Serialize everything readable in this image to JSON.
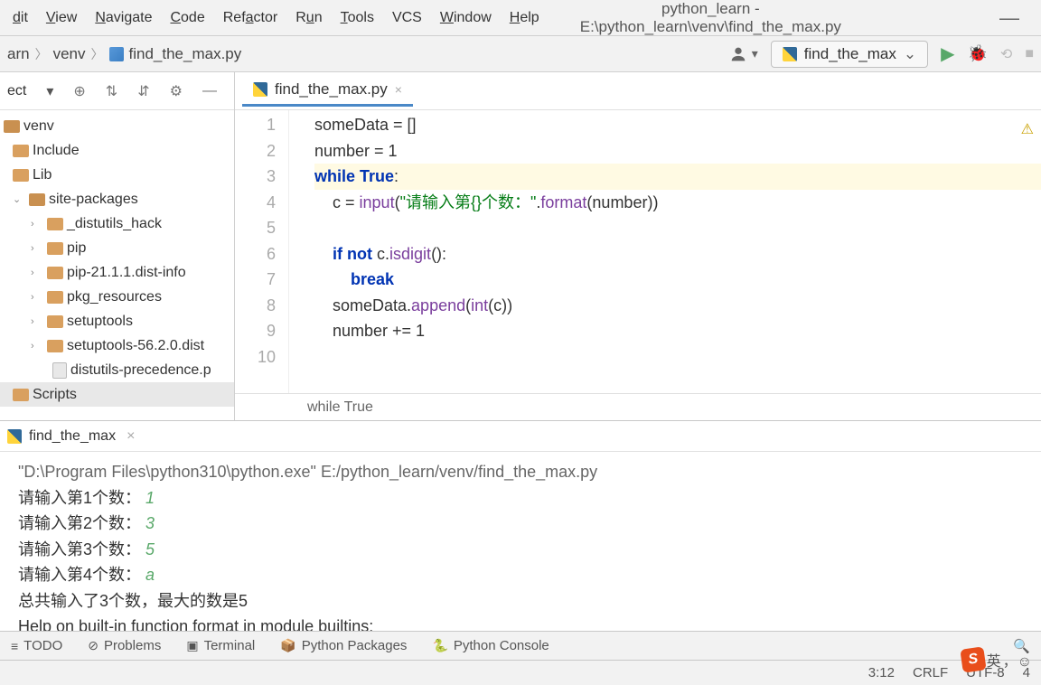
{
  "menu": {
    "items": [
      "dit",
      "View",
      "Navigate",
      "Code",
      "Refactor",
      "Run",
      "Tools",
      "VCS",
      "Window",
      "Help"
    ],
    "underline": [
      0,
      0,
      0,
      0,
      3,
      0,
      0,
      -1,
      0,
      0
    ]
  },
  "window_title": "python_learn - E:\\python_learn\\venv\\find_the_max.py",
  "breadcrumb": {
    "root": "arn",
    "mid": "venv",
    "file": "find_the_max.py"
  },
  "run_config": "find_the_max",
  "sidebar_label": "ect",
  "tree": {
    "root": "venv",
    "include": "Include",
    "lib": "Lib",
    "sitepkg": "site-packages",
    "items": [
      "_distutils_hack",
      "pip",
      "pip-21.1.1.dist-info",
      "pkg_resources",
      "setuptools",
      "setuptools-56.2.0.dist",
      "distutils-precedence.p"
    ],
    "scripts": "Scripts"
  },
  "editor": {
    "filename": "find_the_max.py",
    "code_lines": [
      "someData = []",
      "number = 1",
      "while True:",
      "    c = input(\"请输入第{}个数：\".format(number))",
      "",
      "    if not c.isdigit():",
      "        break",
      "    someData.append(int(c))",
      "    number += 1",
      ""
    ],
    "context": "while True"
  },
  "run_tab": "find_the_max",
  "console": {
    "cmd": "\"D:\\Program Files\\python310\\python.exe\" E:/python_learn/venv/find_the_max.py",
    "lines": [
      {
        "p": "请输入第1个数：",
        "i": "1"
      },
      {
        "p": "请输入第2个数：",
        "i": "3"
      },
      {
        "p": "请输入第3个数：",
        "i": "5"
      },
      {
        "p": "请输入第4个数：",
        "i": "a"
      }
    ],
    "result": "总共输入了3个数，最大的数是5",
    "help": "Help on built-in function format in module builtins:"
  },
  "bottom_tabs": [
    "TODO",
    "Problems",
    "Terminal",
    "Python Packages",
    "Python Console"
  ],
  "status": {
    "pos": "3:12",
    "eol": "CRLF",
    "enc": "UTF-8",
    "indent": "4"
  },
  "ime": "英"
}
